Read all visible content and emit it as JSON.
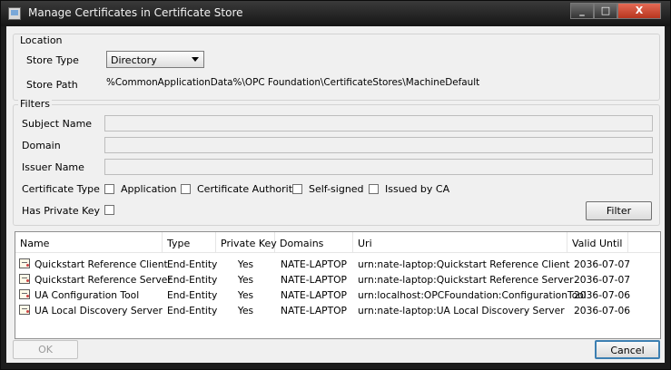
{
  "window": {
    "title": "Manage Certificates in Certificate Store",
    "buttons": {
      "minimize": "_",
      "maximize": "□",
      "close": "X"
    }
  },
  "location": {
    "legend": "Location",
    "store_type_label": "Store Type",
    "store_type_value": "Directory",
    "store_path_label": "Store Path",
    "store_path_value": "%CommonApplicationData%\\OPC Foundation\\CertificateStores\\MachineDefault"
  },
  "filters": {
    "legend": "Filters",
    "subject_name_label": "Subject Name",
    "domain_label": "Domain",
    "issuer_name_label": "Issuer Name",
    "certificate_type_label": "Certificate Type",
    "certificate_types": [
      "Application",
      "Certificate Authority",
      "Self-signed",
      "Issued by CA"
    ],
    "has_private_key_label": "Has Private Key",
    "filter_button": "Filter"
  },
  "table": {
    "columns": [
      "Name",
      "Type",
      "Private Key",
      "Domains",
      "Uri",
      "Valid Until"
    ],
    "rows": [
      [
        "Quickstart Reference Client",
        "End-Entity",
        "Yes",
        "NATE-LAPTOP",
        "urn:nate-laptop:Quickstart Reference Client",
        "2036-07-07"
      ],
      [
        "Quickstart Reference Server",
        "End-Entity",
        "Yes",
        "NATE-LAPTOP",
        "urn:nate-laptop:Quickstart Reference Server",
        "2036-07-07"
      ],
      [
        "UA Configuration Tool",
        "End-Entity",
        "Yes",
        "NATE-LAPTOP",
        "urn:localhost:OPCFoundation:ConfigurationTool",
        "2036-07-06"
      ],
      [
        "UA Local Discovery Server",
        "End-Entity",
        "Yes",
        "NATE-LAPTOP",
        "urn:nate-laptop:UA Local Discovery Server",
        "2036-07-06"
      ]
    ]
  },
  "buttons": {
    "ok": "OK",
    "cancel": "Cancel"
  }
}
